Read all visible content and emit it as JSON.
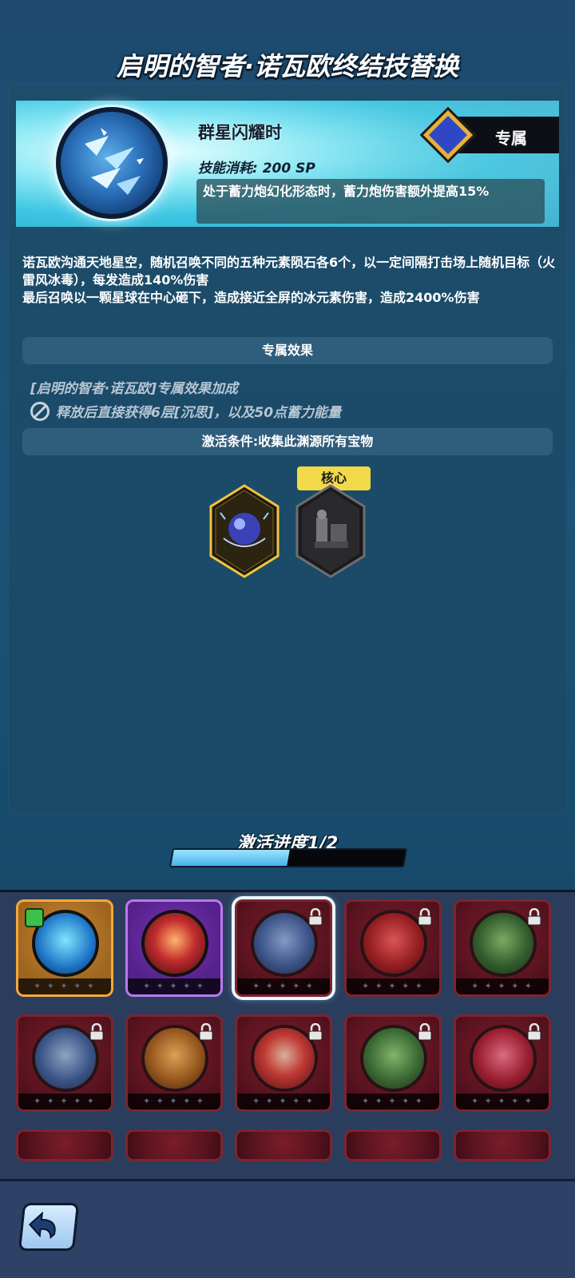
{
  "header": {
    "title": "启明的智者·诺瓦欧终结技替换"
  },
  "skill": {
    "name": "群星闪耀时",
    "cost": "技能消耗: 200 SP",
    "effect": "处于蓄力炮幻化形态时，蓄力炮伤害额外提高15%",
    "exclusive_label": "专属",
    "icon": "ice-shards-icon"
  },
  "description": {
    "text": "诺瓦欧沟通天地星空，随机召唤不同的五种元素陨石各6个，以一定间隔打击场上随机目标（火雷风冰毒），每发造成140%伤害\n最后召唤以一颗星球在中心砸下，造成接近全屏的冰元素伤害，造成2400%伤害"
  },
  "exclusive_effect": {
    "section_title": "专属效果",
    "bonus_title": "[启明的智者·诺瓦欧]专属效果加成",
    "bonus_line": "释放后直接获得6层[沉思]，以及50点蓄力能量"
  },
  "activation": {
    "condition": "激活条件:收集此渊源所有宝物",
    "core_tag": "核心",
    "progress_label": "激活进度1/2",
    "progress_fraction": 0.5,
    "treasures": [
      {
        "name": "orb-treasure-icon",
        "owned": true
      },
      {
        "name": "mechanism-treasure-icon",
        "owned": false
      }
    ]
  },
  "skill_slots": [
    {
      "icon": "ice-crown-icon",
      "frame": "gold",
      "locked": false,
      "selected": false,
      "badge": true
    },
    {
      "icon": "flame-spirit-icon",
      "frame": "purple",
      "locked": false,
      "selected": false
    },
    {
      "icon": "ice-shards-icon",
      "frame": "red",
      "locked": true,
      "selected": true
    },
    {
      "icon": "rune-stone-icon",
      "frame": "red",
      "locked": true,
      "selected": false
    },
    {
      "icon": "dragon-head-icon",
      "frame": "red",
      "locked": true,
      "selected": false
    },
    {
      "icon": "ice-castle-icon",
      "frame": "red",
      "locked": true,
      "selected": false
    },
    {
      "icon": "golden-vortex-icon",
      "frame": "red",
      "locked": true,
      "selected": false
    },
    {
      "icon": "explosion-icon",
      "frame": "red",
      "locked": true,
      "selected": false
    },
    {
      "icon": "green-figure-icon",
      "frame": "red",
      "locked": true,
      "selected": false
    },
    {
      "icon": "red-flower-icon",
      "frame": "red",
      "locked": true,
      "selected": false
    }
  ],
  "slot_stars": "✦ ✦ ✦ ✦ ✦",
  "navigation": {
    "back_icon": "back-arrow-icon"
  }
}
